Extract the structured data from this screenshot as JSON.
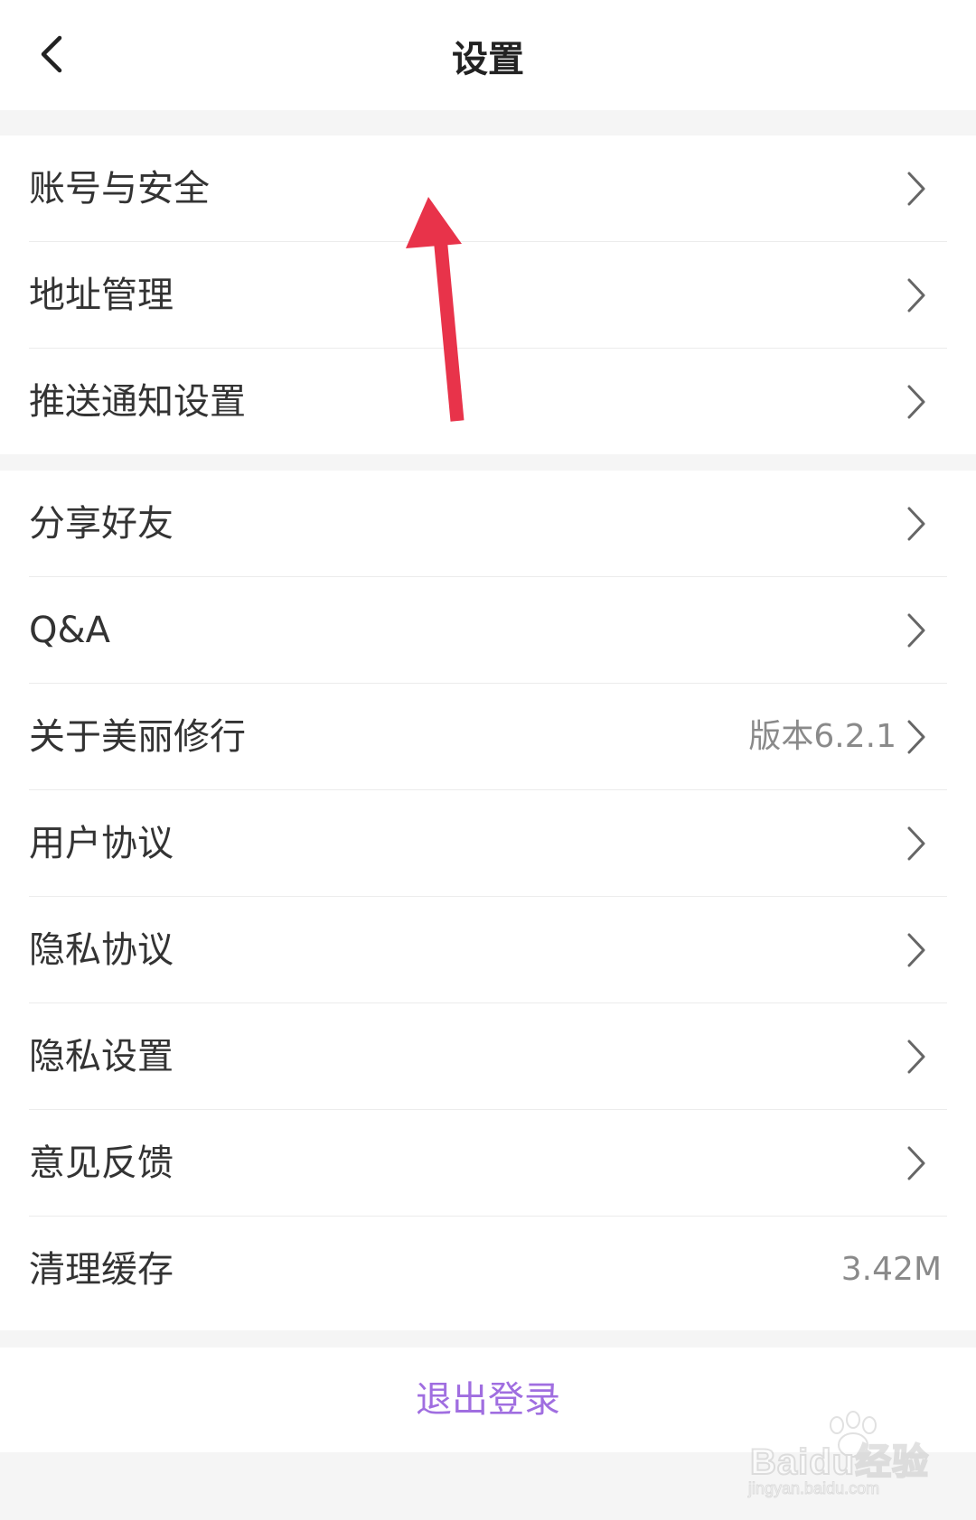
{
  "header": {
    "title": "设置",
    "back_icon": "chevron-left-icon"
  },
  "group1": {
    "items": [
      {
        "label": "账号与安全"
      },
      {
        "label": "地址管理"
      },
      {
        "label": "推送通知设置"
      }
    ]
  },
  "group2": {
    "items": [
      {
        "label": "分享好友"
      },
      {
        "label": "Q&A"
      },
      {
        "label": "关于美丽修行",
        "value": "版本6.2.1"
      },
      {
        "label": "用户协议"
      },
      {
        "label": "隐私协议"
      },
      {
        "label": "隐私设置"
      },
      {
        "label": "意见反馈"
      },
      {
        "label": "清理缓存",
        "value": "3.42M"
      }
    ]
  },
  "logout": {
    "label": "退出登录"
  },
  "colors": {
    "accent": "#a06ee0",
    "annotation_arrow": "#e8334a",
    "background": "#f5f5f5"
  },
  "watermark": {
    "brand": "Baidu经验",
    "url": "jingyan.baidu.com"
  }
}
